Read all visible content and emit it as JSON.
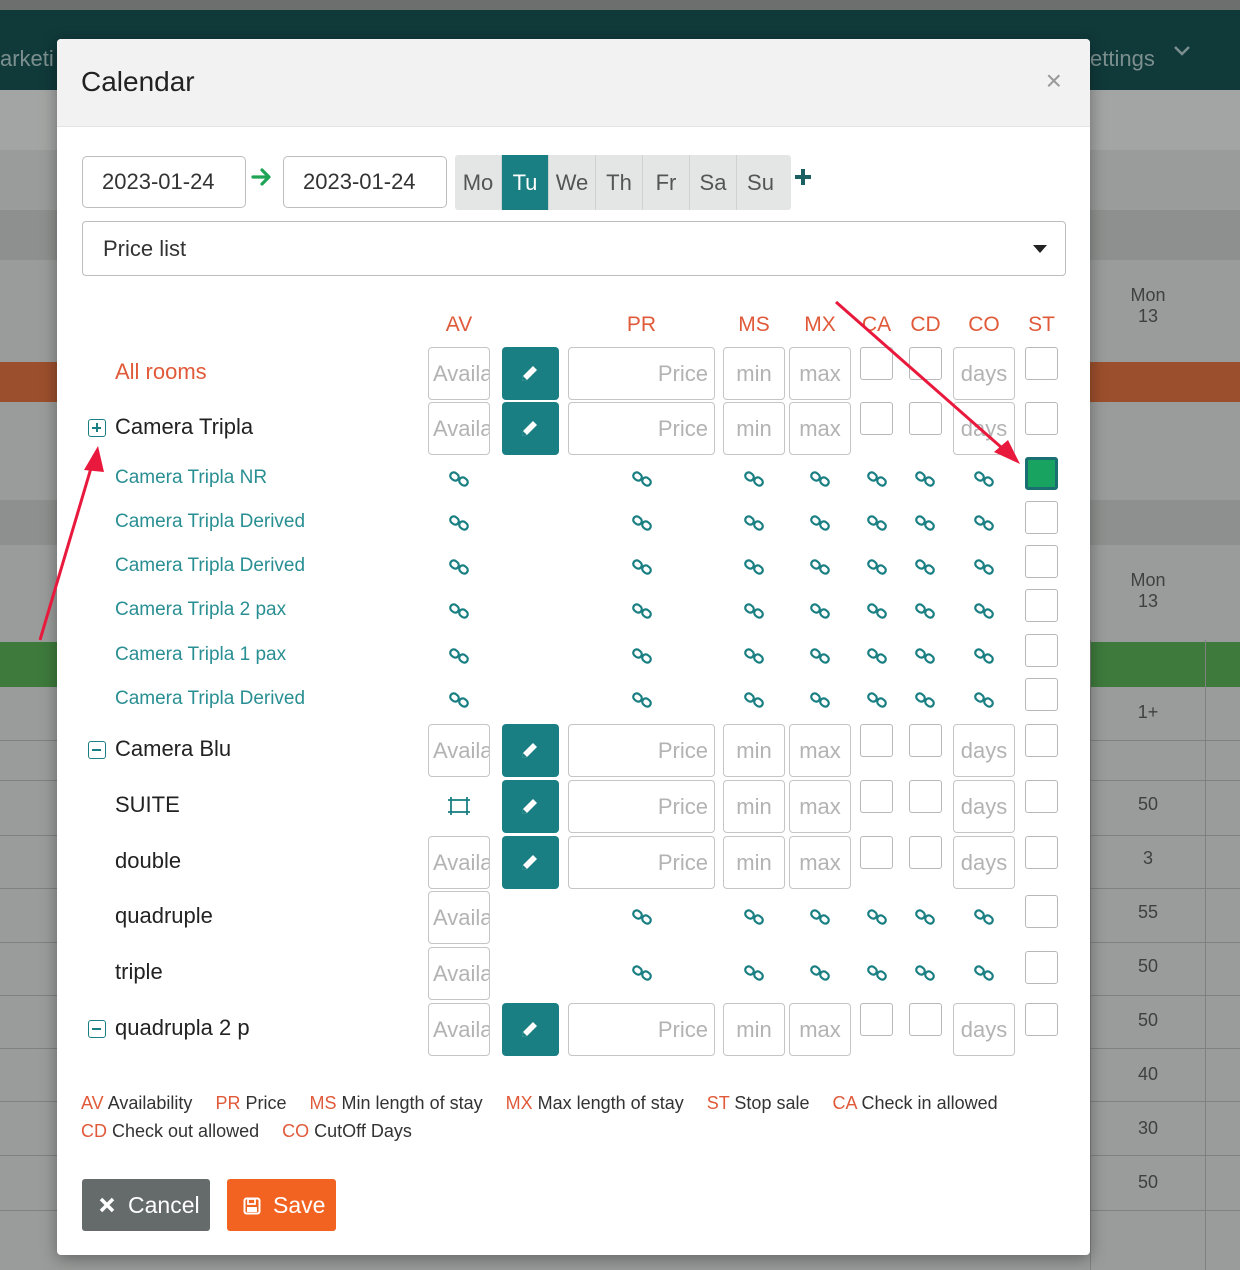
{
  "background": {
    "nav_left_text": "arketi",
    "nav_right_text": "ettings",
    "day_header_1": {
      "day": "Mon",
      "date": "13"
    },
    "day_header_2": {
      "day": "Mon",
      "date": "13"
    },
    "values_col1": [
      "1+",
      "50",
      "3",
      "55",
      "50",
      "50",
      "40",
      "30",
      "50"
    ]
  },
  "modal": {
    "title": "Calendar",
    "close_label": "×",
    "date_from": "2023-01-24",
    "date_to": "2023-01-24",
    "days": [
      {
        "label": "Mo",
        "active": false
      },
      {
        "label": "Tu",
        "active": true
      },
      {
        "label": "We",
        "active": false
      },
      {
        "label": "Th",
        "active": false
      },
      {
        "label": "Fr",
        "active": false
      },
      {
        "label": "Sa",
        "active": false
      },
      {
        "label": "Su",
        "active": false
      }
    ],
    "price_list_select": "Price list",
    "columns": {
      "av": "AV",
      "pr": "PR",
      "ms": "MS",
      "mx": "MX",
      "ca": "CA",
      "cd": "CD",
      "co": "CO",
      "st": "ST"
    },
    "placeholders": {
      "av": "Availa",
      "pr": "Price",
      "ms": "min",
      "mx": "max",
      "co": "days"
    },
    "rows": [
      {
        "label": "All rooms"
      },
      {
        "label": "Camera Tripla"
      },
      {
        "label": "Camera Tripla NR"
      },
      {
        "label": "Camera Tripla Derived"
      },
      {
        "label": "Camera Tripla Derived"
      },
      {
        "label": "Camera Tripla 2 pax"
      },
      {
        "label": "Camera Tripla 1 pax"
      },
      {
        "label": "Camera Tripla Derived"
      },
      {
        "label": "Camera Blu"
      },
      {
        "label": "SUITE"
      },
      {
        "label": "double"
      },
      {
        "label": "quadruple"
      },
      {
        "label": "triple"
      },
      {
        "label": "quadrupla 2 p"
      }
    ],
    "legend": [
      {
        "abbr": "AV",
        "text": "Availability"
      },
      {
        "abbr": "PR",
        "text": "Price"
      },
      {
        "abbr": "MS",
        "text": "Min length of stay"
      },
      {
        "abbr": "MX",
        "text": "Max length of stay"
      },
      {
        "abbr": "ST",
        "text": "Stop sale"
      },
      {
        "abbr": "CA",
        "text": "Check in allowed"
      },
      {
        "abbr": "CD",
        "text": "Check out allowed"
      },
      {
        "abbr": "CO",
        "text": "CutOff Days"
      }
    ],
    "cancel_label": "Cancel",
    "save_label": "Save"
  },
  "colors": {
    "teal": "#1a7f82",
    "accent_red": "#e05a3a",
    "save_orange": "#f26322",
    "cancel_gray": "#656a6a",
    "stop_sale_checked": "#19a360",
    "annotation_arrow": "#e8193c"
  }
}
